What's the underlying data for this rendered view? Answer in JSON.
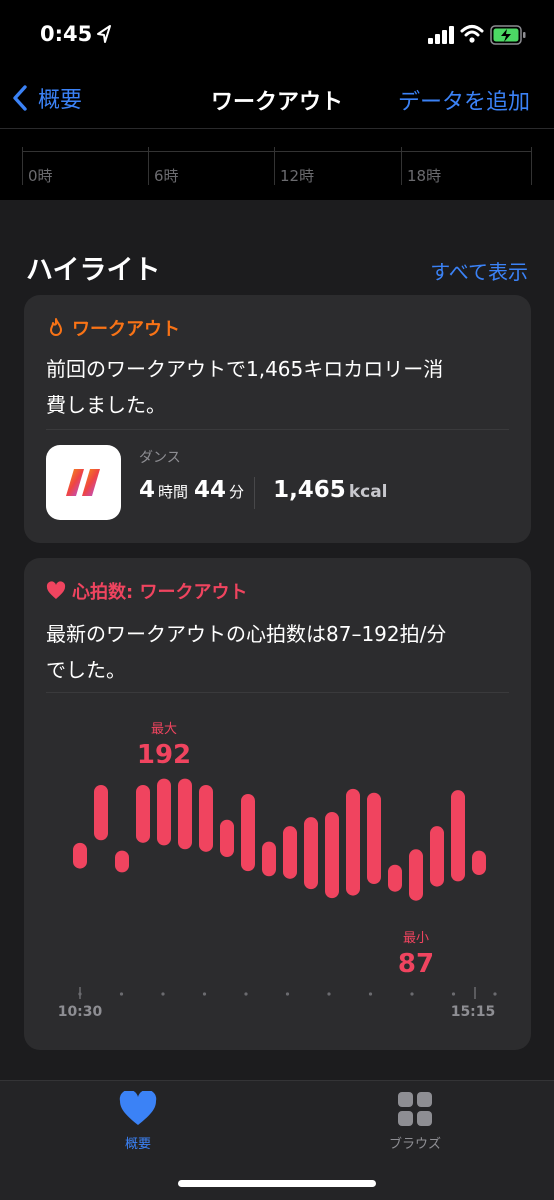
{
  "status_bar": {
    "time": "0:45"
  },
  "nav": {
    "back_label": "概要",
    "title": "ワークアウト",
    "add_label": "データを追加"
  },
  "top_chart": {
    "ticks": [
      "0時",
      "6時",
      "12時",
      "18時"
    ]
  },
  "highlights": {
    "title": "ハイライト",
    "show_all": "すべて表示",
    "workout_card": {
      "header": "ワークアウト",
      "text_line1": "前回のワークアウトで1,465キロカロリー消",
      "text_line2": "費しました。",
      "workout_type": "ダンス",
      "hours": "4",
      "hours_unit": "時間",
      "minutes": "44",
      "minutes_unit": "分",
      "kcal": "1,465",
      "kcal_unit": "kcal",
      "accent_color": "#f97316"
    },
    "heart_card": {
      "header": "心拍数: ワークアウト",
      "text_line1": "最新のワークアウトの心拍数は87–192拍/分",
      "text_line2": "でした。",
      "accent_color": "#f0445f"
    }
  },
  "chart_data": {
    "type": "bar",
    "title": "",
    "bar_style": "floating range (min–max per interval)",
    "ymin": 87,
    "ymax": 192,
    "max_label": "最大",
    "max_value": "192",
    "min_label": "最小",
    "min_value": "87",
    "x_start_label": "10:30",
    "x_end_label": "15:15",
    "ranges": [
      [
        127,
        147
      ],
      [
        149,
        192
      ],
      [
        124,
        141
      ],
      [
        147,
        192
      ],
      [
        145,
        197
      ],
      [
        142,
        197
      ],
      [
        140,
        192
      ],
      [
        136,
        165
      ],
      [
        125,
        185
      ],
      [
        121,
        148
      ],
      [
        119,
        160
      ],
      [
        111,
        167
      ],
      [
        104,
        171
      ],
      [
        106,
        189
      ],
      [
        115,
        186
      ],
      [
        109,
        130
      ],
      [
        102,
        142
      ],
      [
        113,
        160
      ],
      [
        117,
        188
      ],
      [
        122,
        141
      ]
    ],
    "grid": false,
    "color": "#f0445f"
  },
  "tab_bar": {
    "items": [
      {
        "label": "概要",
        "icon": "heart-icon",
        "active": true
      },
      {
        "label": "ブラウズ",
        "icon": "grid-icon",
        "active": false
      }
    ]
  }
}
